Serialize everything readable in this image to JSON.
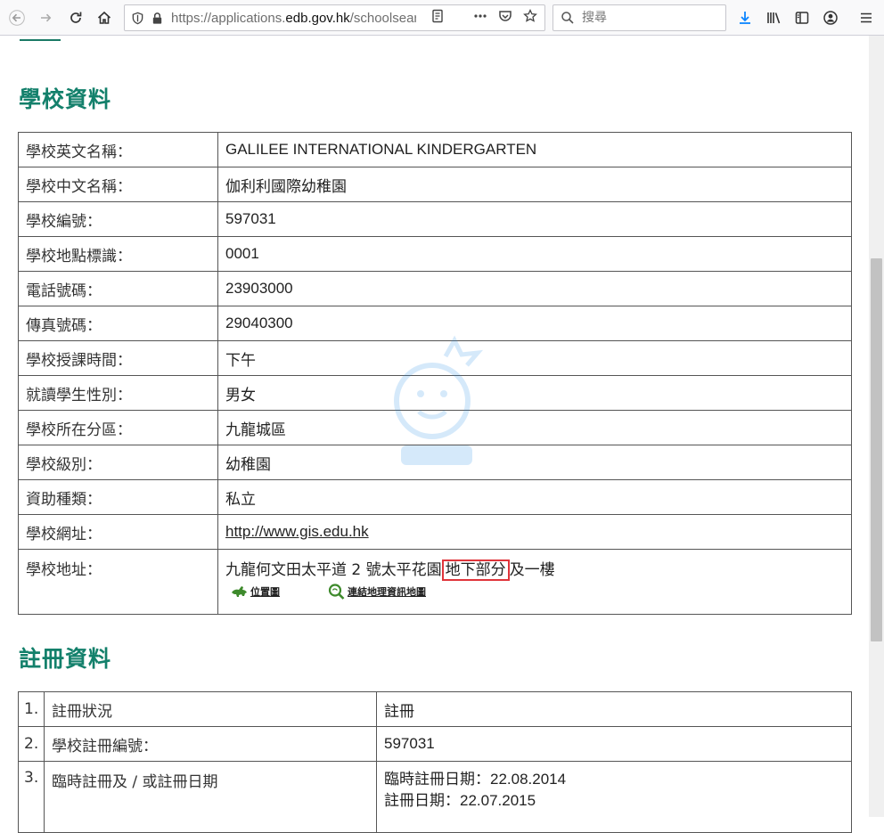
{
  "browser": {
    "url_prefix": "https://applications.",
    "url_host": "edb.gov.hk",
    "url_suffix": "/schoolsearch",
    "search_placeholder": "搜尋"
  },
  "school_info": {
    "title": "學校資料",
    "rows": [
      {
        "label": "學校英文名稱：",
        "value": "GALILEE INTERNATIONAL KINDERGARTEN"
      },
      {
        "label": "學校中文名稱：",
        "value": "伽利利國際幼稚園"
      },
      {
        "label": "學校編號：",
        "value": "597031"
      },
      {
        "label": "學校地點標識：",
        "value": "0001"
      },
      {
        "label": "電話號碼：",
        "value": "23903000"
      },
      {
        "label": "傳真號碼：",
        "value": "29040300"
      },
      {
        "label": "學校授課時間：",
        "value": "下午"
      },
      {
        "label": "就讀學生性別：",
        "value": "男女"
      },
      {
        "label": "學校所在分區：",
        "value": "九龍城區"
      },
      {
        "label": "學校級別：",
        "value": "幼稚園"
      },
      {
        "label": "資助種類：",
        "value": "私立"
      }
    ],
    "website": {
      "label": "學校網址：",
      "value": "http://www.gis.edu.hk"
    },
    "address": {
      "label": "學校地址：",
      "part1": "九龍何文田太平道 2 號太平花園",
      "highlighted": "地下部分",
      "part2": "及一樓",
      "location_map_link": "位置圖",
      "gis_map_link": "連結地理資訊地圖"
    }
  },
  "registration": {
    "title": "註冊資料",
    "rows": [
      {
        "num": "1.",
        "label": "註冊狀況",
        "value1": "註冊"
      },
      {
        "num": "2.",
        "label": "學校註冊編號：",
        "value1": "597031"
      },
      {
        "num": "3.",
        "label": "臨時註冊及 / 或註冊日期",
        "value1": "臨時註冊日期：22.08.2014",
        "value2": "註冊日期：22.07.2015"
      }
    ]
  }
}
